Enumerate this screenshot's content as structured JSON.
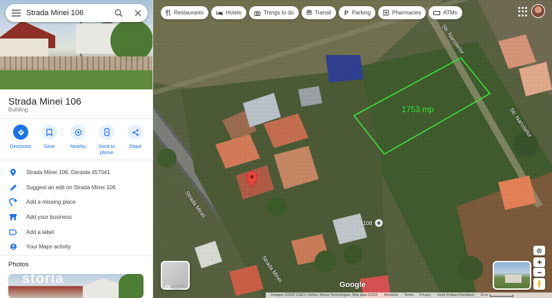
{
  "search": {
    "value": "Strada Minei 106"
  },
  "place": {
    "title": "Strada Minei 106",
    "category": "Building"
  },
  "actions": [
    {
      "label": "Directions",
      "icon": "directions-icon"
    },
    {
      "label": "Save",
      "icon": "bookmark-icon"
    },
    {
      "label": "Nearby",
      "icon": "nearby-icon"
    },
    {
      "label": "Send to phone",
      "icon": "phone-icon"
    },
    {
      "label": "Share",
      "icon": "share-icon"
    }
  ],
  "info_rows": [
    {
      "text": "Strada Minei 106, Derșida 457041",
      "icon": "location-pin-icon"
    },
    {
      "text": "Suggest an edit on Strada Minei 106",
      "icon": "pencil-icon"
    },
    {
      "text": "Add a missing place",
      "icon": "add-place-icon"
    },
    {
      "text": "Add your business",
      "icon": "business-icon"
    },
    {
      "text": "Add a label",
      "icon": "label-icon"
    },
    {
      "text": "Your Maps activity",
      "icon": "history-icon"
    }
  ],
  "photos": {
    "heading": "Photos",
    "watermark": "storia"
  },
  "chips": [
    {
      "label": "Restaurants",
      "icon": "fork-knife-icon"
    },
    {
      "label": "Hotels",
      "icon": "bed-icon"
    },
    {
      "label": "Things to do",
      "icon": "camera-icon"
    },
    {
      "label": "Transit",
      "icon": "bus-icon"
    },
    {
      "label": "Parking",
      "icon": "parking-icon"
    },
    {
      "label": "Pharmacies",
      "icon": "pharmacy-icon"
    },
    {
      "label": "ATMs",
      "icon": "atm-icon"
    }
  ],
  "map": {
    "area_label": "1753 mp",
    "street_1": "Strada Minei",
    "street_2": "Strada Minei",
    "street_3": "Str. Narciselor",
    "street_4": "Str. Narciselor",
    "address_marker": "108",
    "layers_label": "Layers",
    "logo": "Google",
    "attribution": "Imagery ©2025 CNES / Airbus, Maxar Technologies, Map data ©2025",
    "country": "Romania",
    "terms": "Terms",
    "privacy": "Privacy",
    "feedback": "Send Product Feedback",
    "scale": "20 m",
    "plot_color": "#39e639",
    "pin_color": "#e8453c"
  }
}
